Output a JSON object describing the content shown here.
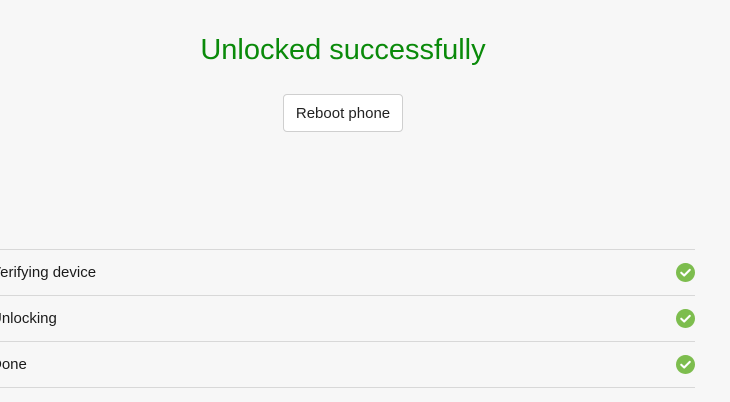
{
  "status": {
    "title": "Unlocked successfully",
    "title_color": "#0a8a0a"
  },
  "actions": {
    "reboot_label": "Reboot phone"
  },
  "steps": [
    {
      "label": "Verifying device",
      "state": "done",
      "icon": "check-circle-icon"
    },
    {
      "label": "Unlocking",
      "state": "done",
      "icon": "check-circle-icon"
    },
    {
      "label": "Done",
      "state": "done",
      "icon": "check-circle-icon"
    }
  ],
  "colors": {
    "check": "#7dbd4e",
    "background": "#f7f7f7",
    "divider": "#d8d8d8"
  }
}
